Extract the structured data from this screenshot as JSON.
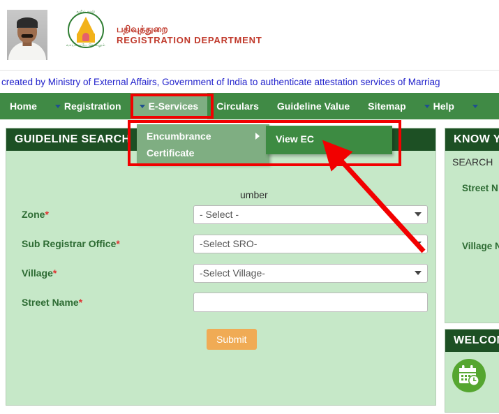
{
  "header": {
    "brand_tamil": "பதிவுத்துறை",
    "brand_english": "REGISTRATION DEPARTMENT",
    "emblem_top_text": "தமிழ் நாடு",
    "emblem_bottom_text": "வாய்மையே வெல்லும்",
    "photo_alt": "chief-minister-photo"
  },
  "marquee": {
    "text": "created by Ministry of External Affairs, Government of India to authenticate attestation services of Marriag"
  },
  "nav": {
    "items": [
      {
        "label": "Home",
        "has_caret": false,
        "active": false
      },
      {
        "label": "Registration",
        "has_caret": true,
        "active": false
      },
      {
        "label": "E-Services",
        "has_caret": true,
        "active": true
      },
      {
        "label": "Circulars",
        "has_caret": false,
        "active": false
      },
      {
        "label": "Guideline Value",
        "has_caret": false,
        "active": false
      },
      {
        "label": "Sitemap",
        "has_caret": false,
        "active": false
      },
      {
        "label": "Help",
        "has_caret": true,
        "active": false
      }
    ],
    "background": "#408a45",
    "active_background": "#7fae82"
  },
  "menu": {
    "level1": [
      {
        "label": "Encumbrance",
        "submenu": true
      },
      {
        "label": "Certificate",
        "submenu": false
      }
    ],
    "level2": [
      {
        "label": "View EC"
      }
    ]
  },
  "guideline": {
    "title": "GUIDELINE SEARCH",
    "tab_label_partial": "umber",
    "fields": [
      {
        "label": "Zone",
        "required": true,
        "type": "select",
        "value": "- Select -"
      },
      {
        "label": "Sub Registrar Office",
        "required": true,
        "type": "select",
        "value": "-Select SRO-"
      },
      {
        "label": "Village",
        "required": true,
        "type": "select",
        "value": "-Select Village-"
      },
      {
        "label": "Street Name",
        "required": true,
        "type": "text",
        "value": "",
        "placeholder": ""
      }
    ],
    "submit_label": "Submit"
  },
  "sidebar": {
    "know_panel": {
      "title": "KNOW Y",
      "search_label": "SEARCH",
      "row1": "Street N",
      "row2": "Village N"
    },
    "welcome_panel": {
      "title": "WELCOM",
      "icon": "calendar-clock-icon"
    }
  },
  "colors": {
    "nav_green": "#408a45",
    "header_dark_green": "#1d5024",
    "panel_bg": "#c6e8c8",
    "submit_orange": "#f0ab55",
    "annotation_red": "#f20000",
    "marquee_blue": "#2222cc",
    "label_green": "#2d6b33",
    "required_red": "#e03131"
  }
}
